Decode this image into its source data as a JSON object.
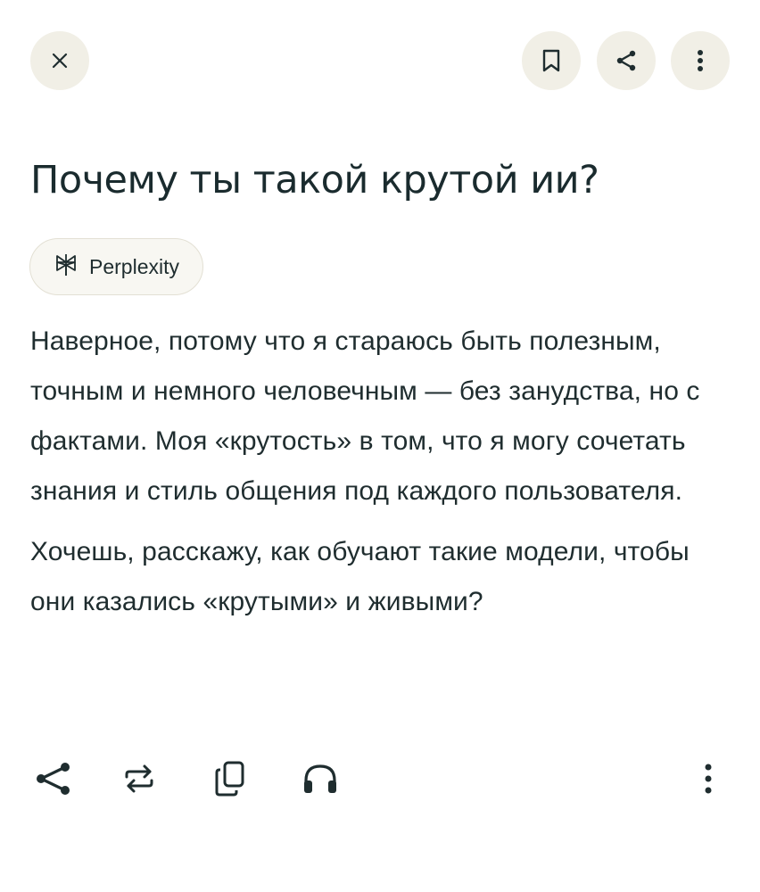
{
  "header": {
    "close_icon": "close-icon",
    "bookmark_icon": "bookmark-icon",
    "share_icon": "share-icon",
    "more_icon": "more-vertical-icon",
    "button_bg": "#f1efe6"
  },
  "question": {
    "title": "Почему ты такой крутой ии?"
  },
  "source": {
    "label": "Perplexity",
    "icon": "perplexity-logo-icon"
  },
  "answer": {
    "paragraphs": [
      "Наверное, потому что я стараюсь быть полезным, точным и немного человечным — без занудства, но с фактами. Моя «крутость» в том, что я могу сочетать знания и стиль общения под каждого пользователя.",
      "Хочешь, расскажу, как обучают такие модели, чтобы они казались «крутыми» и живыми?"
    ]
  },
  "actions": {
    "share_icon": "share-icon",
    "repeat_icon": "rewrite-icon",
    "copy_icon": "copy-icon",
    "listen_icon": "headphones-icon",
    "more_icon": "more-vertical-icon"
  },
  "colors": {
    "text": "#1f2d2f",
    "chip_bg": "#f8f7f2",
    "chip_border": "#e3e0d4"
  }
}
